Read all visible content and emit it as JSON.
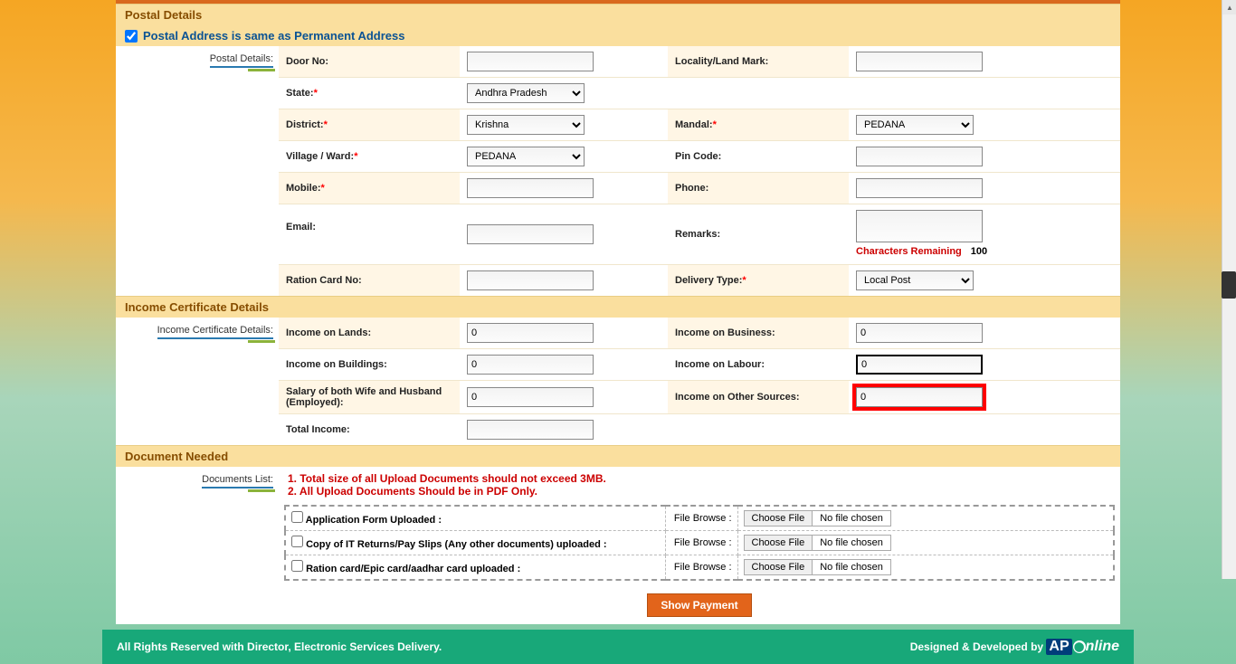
{
  "sections": {
    "postal_details": "Postal Details",
    "postal_same": "Postal Address is same as Permanent Address",
    "income_details": "Income Certificate Details",
    "document_needed": "Document Needed"
  },
  "side_labels": {
    "postal": "Postal Details:",
    "income": "Income Certificate Details:",
    "documents": "Documents List:"
  },
  "postal": {
    "door_no": {
      "label": "Door No:",
      "value": ""
    },
    "locality": {
      "label": "Locality/Land Mark:",
      "value": ""
    },
    "state": {
      "label": "State:",
      "value": "Andhra Pradesh",
      "required": true
    },
    "district": {
      "label": "District:",
      "value": "Krishna",
      "required": true
    },
    "mandal": {
      "label": "Mandal:",
      "value": "PEDANA",
      "required": true
    },
    "village": {
      "label": "Village / Ward:",
      "value": "PEDANA",
      "required": true
    },
    "pincode": {
      "label": "Pin Code:",
      "value": ""
    },
    "mobile": {
      "label": "Mobile:",
      "value": "",
      "required": true
    },
    "phone": {
      "label": "Phone:",
      "value": ""
    },
    "email": {
      "label": "Email:",
      "value": ""
    },
    "remarks": {
      "label": "Remarks:",
      "value": ""
    },
    "remarks_note": "Characters Remaining",
    "remarks_count": "100",
    "ration": {
      "label": "Ration Card No:",
      "value": ""
    },
    "delivery": {
      "label": "Delivery Type:",
      "value": "Local Post",
      "required": true
    }
  },
  "income": {
    "lands": {
      "label": "Income on Lands:",
      "value": "0"
    },
    "business": {
      "label": "Income on Business:",
      "value": "0"
    },
    "buildings": {
      "label": "Income on Buildings:",
      "value": "0"
    },
    "labour": {
      "label": "Income on Labour:",
      "value": "0"
    },
    "salary": {
      "label": "Salary of both Wife and Husband (Employed):",
      "value": "0"
    },
    "other": {
      "label": "Income on Other Sources:",
      "value": "0"
    },
    "total": {
      "label": "Total Income:",
      "value": ""
    }
  },
  "documents": {
    "warn1": "1. Total size of all Upload Documents should not exceed 3MB.",
    "warn2": "2. All Upload Documents Should be in PDF Only.",
    "rows": {
      "app_form": "Application Form Uploaded :",
      "it_returns": "Copy of IT Returns/Pay Slips (Any other documents) uploaded :",
      "ration_epic": "Ration card/Epic card/aadhar card uploaded :"
    },
    "file_browse": "File Browse :",
    "choose_file": "Choose File",
    "no_file": "No file chosen"
  },
  "buttons": {
    "show_payment": "Show Payment"
  },
  "footer": {
    "left": "All Rights Reserved with Director, Electronic Services Delivery.",
    "right": "Designed & Developed by",
    "logo_ap": "AP",
    "logo_nline": "nline"
  }
}
